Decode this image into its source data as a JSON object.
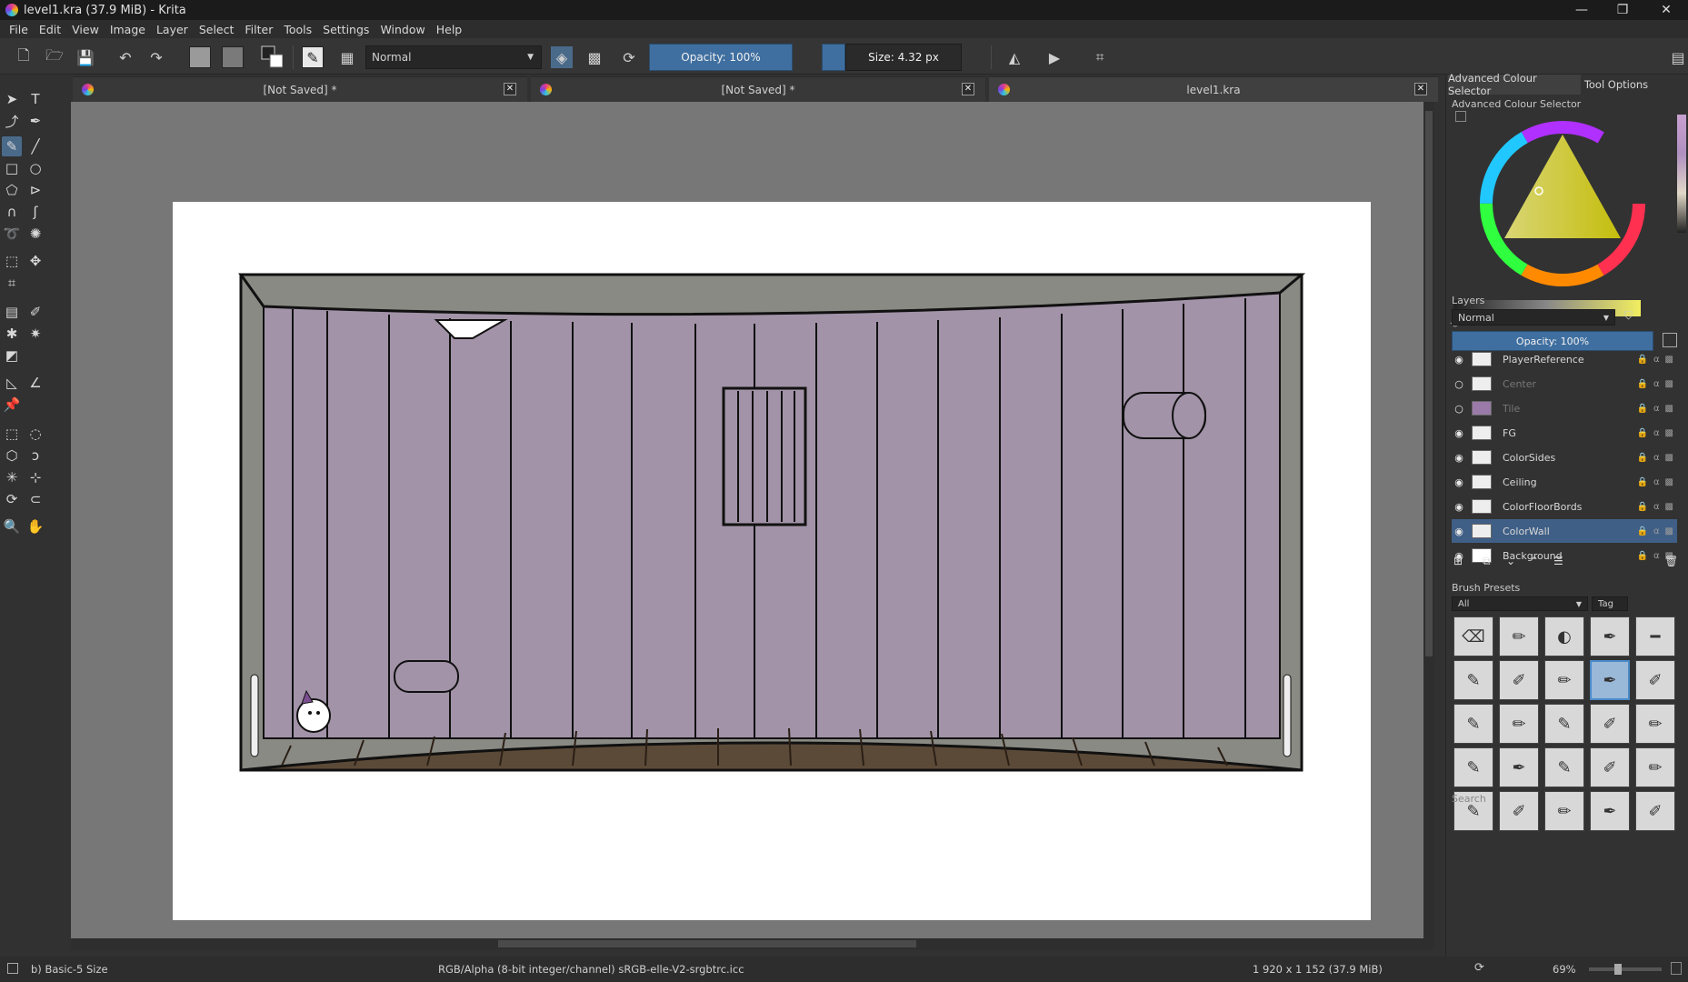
{
  "titlebar": {
    "title": "level1.kra (37.9 MiB)  - Krita",
    "minimize": "—",
    "maximize": "❐",
    "close": "✕"
  },
  "menu": [
    "File",
    "Edit",
    "View",
    "Image",
    "Layer",
    "Select",
    "Filter",
    "Tools",
    "Settings",
    "Window",
    "Help"
  ],
  "toolbar": {
    "blend_mode": "Normal",
    "opacity": "Opacity: 100%",
    "size": "Size: 4.32 px"
  },
  "tabs": [
    {
      "label": "[Not Saved]  *"
    },
    {
      "label": "[Not Saved]  *"
    },
    {
      "label": "level1.kra"
    }
  ],
  "dock": {
    "tabs": [
      "Advanced Colour Selector",
      "Tool Options"
    ],
    "colour_selector_title": "Advanced Colour Selector",
    "layers_title": "Layers",
    "layers_blend": "Normal",
    "layers_opacity": "Opacity:  100%",
    "layers": [
      {
        "name": "PlayerReference",
        "visible": true
      },
      {
        "name": "Center",
        "visible": false
      },
      {
        "name": "Tile",
        "visible": false
      },
      {
        "name": "FG",
        "visible": true
      },
      {
        "name": "ColorSides",
        "visible": true
      },
      {
        "name": "Ceiling",
        "visible": true
      },
      {
        "name": "ColorFloorBords",
        "visible": true
      },
      {
        "name": "ColorWall",
        "visible": true,
        "selected": true
      },
      {
        "name": "Background",
        "visible": true
      }
    ],
    "brush_presets_title": "Brush Presets",
    "brush_filter": "All",
    "brush_tag": "Tag",
    "brush_search": "Search"
  },
  "status": {
    "brush": "b) Basic-5 Size",
    "color_info": "RGB/Alpha (8-bit integer/channel)  sRGB-elle-V2-srgbtrc.icc",
    "dimensions": "1 920 x 1 152 (37.9 MiB)",
    "zoom": "69%"
  },
  "colors": {
    "wall": "#a293a8",
    "frame": "#8a8a84",
    "floor": "#5c4a38",
    "accent": "#3f5f86"
  }
}
